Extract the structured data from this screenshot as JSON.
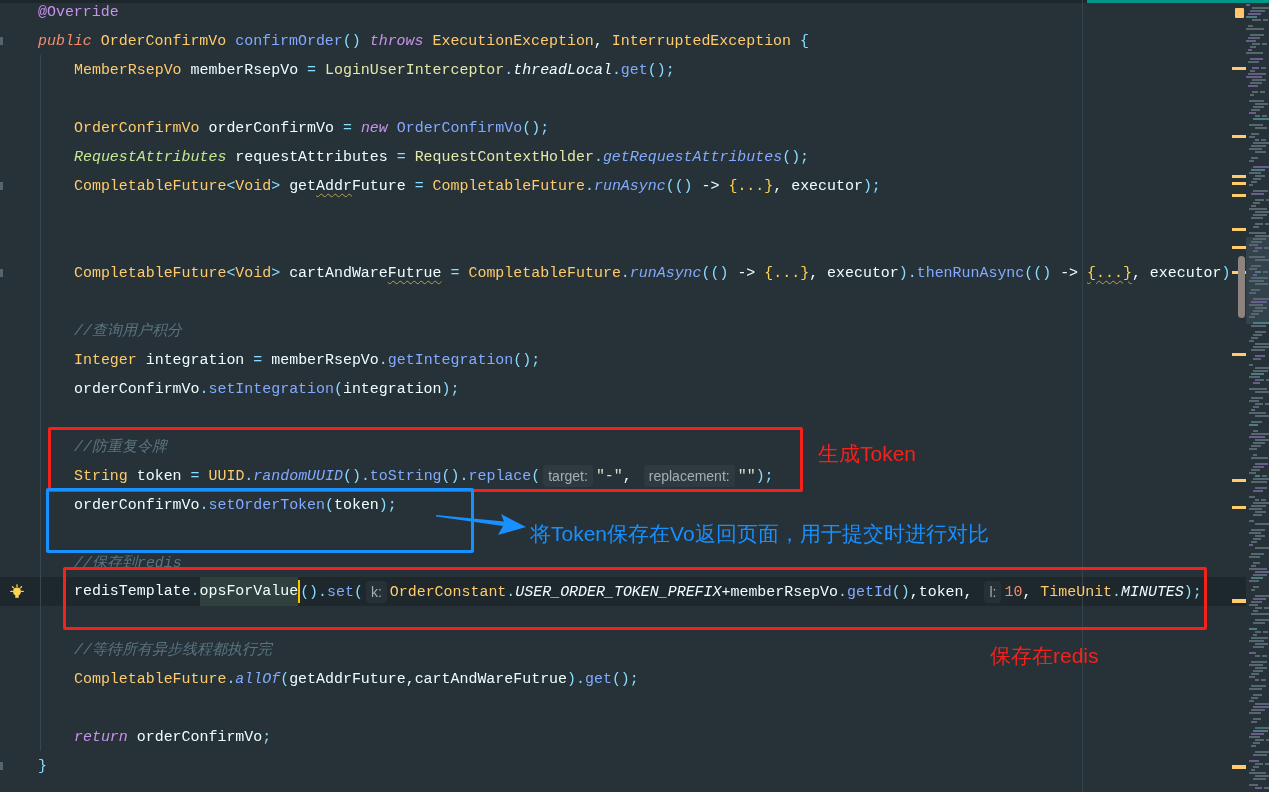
{
  "editor": {
    "lines": [
      {
        "kind": "code",
        "current": false,
        "tokens": [
          {
            "text": "@Override",
            "kind": "annotation"
          }
        ]
      },
      {
        "kind": "code",
        "current": false,
        "gutter": {
          "kind": "fold"
        },
        "tokens": [
          {
            "text": "public ",
            "kind": "modifier"
          },
          {
            "text": "OrderConfirmVo ",
            "kind": "type"
          },
          {
            "text": "confirmOrder",
            "kind": "method"
          },
          {
            "text": "() ",
            "kind": "punct"
          },
          {
            "text": "throws ",
            "kind": "keyword"
          },
          {
            "text": "ExecutionException",
            "kind": "type"
          },
          {
            "text": ", ",
            "kind": "plain"
          },
          {
            "text": "InterruptedException ",
            "kind": "type"
          },
          {
            "text": "{",
            "kind": "punct"
          }
        ],
        "children": [
          {
            "kind": "code",
            "current": false,
            "tokens": [
              {
                "text": "MemberRsepVo",
                "kind": "type"
              },
              {
                "text": " memberRsepVo ",
                "kind": "plain"
              },
              {
                "text": "= ",
                "kind": "punct"
              },
              {
                "text": "LoginUserInterceptor",
                "kind": "util"
              },
              {
                "text": ".",
                "kind": "punct"
              },
              {
                "text": "threadLocal",
                "kind": "static-field"
              },
              {
                "text": ".",
                "kind": "punct"
              },
              {
                "text": "get",
                "kind": "method"
              },
              {
                "text": "();",
                "kind": "punct"
              }
            ]
          },
          {
            "kind": "blank",
            "current": false
          },
          {
            "kind": "code",
            "current": false,
            "tokens": [
              {
                "text": "OrderConfirmVo",
                "kind": "type"
              },
              {
                "text": " orderConfirmVo ",
                "kind": "plain"
              },
              {
                "text": "= ",
                "kind": "punct"
              },
              {
                "text": "new ",
                "kind": "keyword"
              },
              {
                "text": "OrderConfirmVo",
                "kind": "method"
              },
              {
                "text": "();",
                "kind": "punct"
              }
            ]
          },
          {
            "kind": "code",
            "current": false,
            "tokens": [
              {
                "text": "RequestAttributes",
                "kind": "interface"
              },
              {
                "text": " requestAttributes ",
                "kind": "plain"
              },
              {
                "text": "= ",
                "kind": "punct"
              },
              {
                "text": "RequestContextHolder",
                "kind": "util"
              },
              {
                "text": ".",
                "kind": "punct"
              },
              {
                "text": "getRequestAttributes",
                "kind": "static-method"
              },
              {
                "text": "();",
                "kind": "punct"
              }
            ]
          },
          {
            "kind": "code",
            "current": false,
            "gutter": {
              "kind": "fold"
            },
            "tokens": [
              {
                "text": "CompletableFuture",
                "kind": "type"
              },
              {
                "text": "<",
                "kind": "punct"
              },
              {
                "text": "Void",
                "kind": "type"
              },
              {
                "text": ">",
                "kind": "punct"
              },
              {
                "text": " get",
                "kind": "plain"
              },
              {
                "text": "Addr",
                "kind": "typo"
              },
              {
                "text": "Future ",
                "kind": "plain"
              },
              {
                "text": "= ",
                "kind": "punct"
              },
              {
                "text": "CompletableFuture",
                "kind": "type"
              },
              {
                "text": ".",
                "kind": "punct"
              },
              {
                "text": "runAsync",
                "kind": "static-method"
              },
              {
                "text": "(() ",
                "kind": "punct"
              },
              {
                "text": "-> ",
                "kind": "plain"
              },
              {
                "text": "{...}",
                "kind": "folded"
              },
              {
                "text": ", executor",
                "kind": "plain"
              },
              {
                "text": ");",
                "kind": "punct"
              }
            ]
          },
          {
            "kind": "blank",
            "current": false
          },
          {
            "kind": "blank",
            "current": false
          },
          {
            "kind": "code",
            "current": false,
            "gutter": {
              "kind": "fold"
            },
            "tokens": [
              {
                "text": "CompletableFuture",
                "kind": "type"
              },
              {
                "text": "<",
                "kind": "punct"
              },
              {
                "text": "Void",
                "kind": "type"
              },
              {
                "text": ">",
                "kind": "punct"
              },
              {
                "text": " cartAndWare",
                "kind": "plain"
              },
              {
                "text": "Futrue",
                "kind": "typo"
              },
              {
                "text": " = ",
                "kind": "punct"
              },
              {
                "text": "CompletableFuture",
                "kind": "type"
              },
              {
                "text": ".",
                "kind": "punct"
              },
              {
                "text": "runAsync",
                "kind": "static-method"
              },
              {
                "text": "(() ",
                "kind": "punct"
              },
              {
                "text": "-> ",
                "kind": "plain"
              },
              {
                "text": "{...}",
                "kind": "folded"
              },
              {
                "text": ", executor",
                "kind": "plain"
              },
              {
                "text": ").",
                "kind": "punct"
              },
              {
                "text": "thenRunAsync",
                "kind": "method"
              },
              {
                "text": "(() ",
                "kind": "punct"
              },
              {
                "text": "-> ",
                "kind": "plain"
              },
              {
                "text": "{...}",
                "kind": "folded-warning"
              },
              {
                "text": ", executor",
                "kind": "plain"
              },
              {
                "text": ")",
                "kind": "punct"
              }
            ]
          },
          {
            "kind": "blank",
            "current": false
          },
          {
            "kind": "code",
            "current": false,
            "tokens": [
              {
                "text": "//查询用户积分",
                "kind": "comment"
              }
            ]
          },
          {
            "kind": "code",
            "current": false,
            "tokens": [
              {
                "text": "Integer",
                "kind": "type"
              },
              {
                "text": " integration ",
                "kind": "plain"
              },
              {
                "text": "= ",
                "kind": "punct"
              },
              {
                "text": "memberRsepVo",
                "kind": "plain"
              },
              {
                "text": ".",
                "kind": "punct"
              },
              {
                "text": "getIntegration",
                "kind": "method"
              },
              {
                "text": "();",
                "kind": "punct"
              }
            ]
          },
          {
            "kind": "code",
            "current": false,
            "tokens": [
              {
                "text": "orderConfirmVo",
                "kind": "plain"
              },
              {
                "text": ".",
                "kind": "punct"
              },
              {
                "text": "setIntegration",
                "kind": "method"
              },
              {
                "text": "(",
                "kind": "punct"
              },
              {
                "text": "integration",
                "kind": "plain"
              },
              {
                "text": ");",
                "kind": "punct"
              }
            ]
          },
          {
            "kind": "blank",
            "current": false
          },
          {
            "kind": "code",
            "current": false,
            "tokens": [
              {
                "text": "//防重复令牌",
                "kind": "comment"
              }
            ]
          },
          {
            "kind": "code",
            "current": false,
            "tokens": [
              {
                "text": "String",
                "kind": "type"
              },
              {
                "text": " token ",
                "kind": "plain"
              },
              {
                "text": "= ",
                "kind": "punct"
              },
              {
                "text": "UUID",
                "kind": "type"
              },
              {
                "text": ".",
                "kind": "punct"
              },
              {
                "text": "randomUUID",
                "kind": "static-method"
              },
              {
                "text": "().",
                "kind": "punct"
              },
              {
                "text": "toString",
                "kind": "method"
              },
              {
                "text": "().",
                "kind": "punct"
              },
              {
                "text": "replace",
                "kind": "method"
              },
              {
                "text": "(",
                "kind": "punct"
              },
              {
                "text": "target:",
                "kind": "hint"
              },
              {
                "text": "\"-\"",
                "kind": "string"
              },
              {
                "text": ", ",
                "kind": "plain"
              },
              {
                "text": "replacement:",
                "kind": "hint"
              },
              {
                "text": "\"\"",
                "kind": "string"
              },
              {
                "text": ");",
                "kind": "punct"
              }
            ]
          },
          {
            "kind": "code",
            "current": false,
            "tokens": [
              {
                "text": "orderConfirmVo",
                "kind": "plain"
              },
              {
                "text": ".",
                "kind": "punct"
              },
              {
                "text": "setOrderToken",
                "kind": "method"
              },
              {
                "text": "(",
                "kind": "punct"
              },
              {
                "text": "token",
                "kind": "plain"
              },
              {
                "text": ");",
                "kind": "punct"
              }
            ]
          },
          {
            "kind": "blank",
            "current": false
          },
          {
            "kind": "code",
            "current": false,
            "tokens": [
              {
                "text": "//保存到redis",
                "kind": "comment"
              }
            ]
          },
          {
            "kind": "code",
            "current": true,
            "gutter": {
              "kind": "bulb"
            },
            "tokens": [
              {
                "text": "redisTemplate",
                "kind": "plain"
              },
              {
                "text": ".",
                "kind": "punct"
              },
              {
                "text": "opsForValue",
                "kind": "highlight"
              },
              {
                "kind": "caret"
              },
              {
                "text": "().",
                "kind": "punct"
              },
              {
                "text": "set",
                "kind": "method"
              },
              {
                "text": "(",
                "kind": "punct"
              },
              {
                "text": "k:",
                "kind": "hint"
              },
              {
                "text": "OrderConstant",
                "kind": "type"
              },
              {
                "text": ".",
                "kind": "punct"
              },
              {
                "text": "USER_ORDER_TOKEN_PREFIX",
                "kind": "static-field"
              },
              {
                "text": "+memberRsepVo",
                "kind": "plain"
              },
              {
                "text": ".",
                "kind": "punct"
              },
              {
                "text": "getId",
                "kind": "method"
              },
              {
                "text": "()",
                "kind": "punct"
              },
              {
                "text": ",token, ",
                "kind": "plain"
              },
              {
                "text": "l:",
                "kind": "hint"
              },
              {
                "text": "10",
                "kind": "number"
              },
              {
                "text": ", ",
                "kind": "plain"
              },
              {
                "text": "TimeUnit",
                "kind": "type"
              },
              {
                "text": ".",
                "kind": "punct"
              },
              {
                "text": "MINUTES",
                "kind": "static-field"
              },
              {
                "text": ");",
                "kind": "punct"
              }
            ]
          },
          {
            "kind": "blank",
            "current": false
          },
          {
            "kind": "code",
            "current": false,
            "tokens": [
              {
                "text": "//等待所有异步线程都执行完",
                "kind": "comment"
              }
            ]
          },
          {
            "kind": "code",
            "current": false,
            "tokens": [
              {
                "text": "CompletableFuture",
                "kind": "type"
              },
              {
                "text": ".",
                "kind": "punct"
              },
              {
                "text": "allOf",
                "kind": "static-method"
              },
              {
                "text": "(",
                "kind": "punct"
              },
              {
                "text": "getAddrFuture,cartAndWareFutrue",
                "kind": "plain"
              },
              {
                "text": ").",
                "kind": "punct"
              },
              {
                "text": "get",
                "kind": "method"
              },
              {
                "text": "();",
                "kind": "punct"
              }
            ]
          },
          {
            "kind": "blank",
            "current": false
          },
          {
            "kind": "code",
            "current": false,
            "tokens": [
              {
                "text": "return ",
                "kind": "keyword"
              },
              {
                "text": "orderConfirmVo",
                "kind": "plain"
              },
              {
                "text": ";",
                "kind": "punct"
              }
            ]
          }
        ]
      },
      {
        "kind": "code",
        "current": false,
        "gutter": {
          "kind": "fold"
        },
        "tokens": [
          {
            "text": "}",
            "kind": "punct"
          }
        ]
      }
    ]
  },
  "annotations": [
    {
      "kind": "box",
      "color": "#f5221b"
    },
    {
      "kind": "label",
      "text": "生成Token",
      "color": "#f5221b"
    },
    {
      "kind": "box",
      "color": "#1890ff"
    },
    {
      "kind": "arrow",
      "color": "#1890ff"
    },
    {
      "kind": "label",
      "text": "将Token保存在Vo返回页面，用于提交时进行对比",
      "color": "#1890ff"
    },
    {
      "kind": "box",
      "color": "#f5221b"
    },
    {
      "kind": "label",
      "text": "保存在redis",
      "color": "#f5221b"
    }
  ]
}
